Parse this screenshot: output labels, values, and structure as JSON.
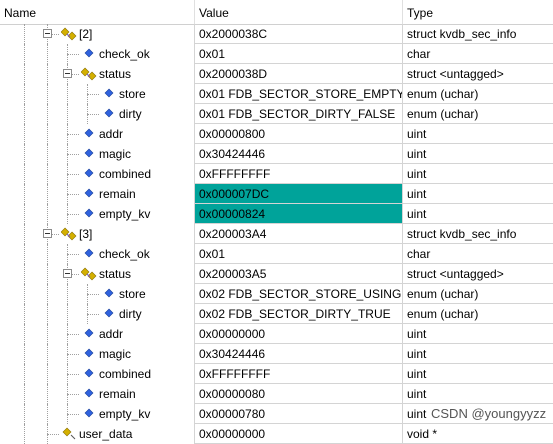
{
  "columns": {
    "name": "Name",
    "value": "Value",
    "type": "Type"
  },
  "rows": [
    {
      "id": "r0",
      "name": "[2]",
      "value": "0x2000038C",
      "type": "struct kvdb_sec_info",
      "level": 0,
      "kind": "struct",
      "expandable": true
    },
    {
      "id": "r1",
      "name": "check_ok",
      "value": "0x01",
      "type": "char",
      "level": 1,
      "kind": "field"
    },
    {
      "id": "r2",
      "name": "status",
      "value": "0x2000038D",
      "type": "struct <untagged>",
      "level": 1,
      "kind": "struct",
      "expandable": true
    },
    {
      "id": "r3",
      "name": "store",
      "value": "0x01 FDB_SECTOR_STORE_EMPTY",
      "type": "enum (uchar)",
      "level": 2,
      "kind": "field"
    },
    {
      "id": "r4",
      "name": "dirty",
      "value": "0x01 FDB_SECTOR_DIRTY_FALSE",
      "type": "enum (uchar)",
      "level": 2,
      "kind": "field"
    },
    {
      "id": "r5",
      "name": "addr",
      "value": "0x00000800",
      "type": "uint",
      "level": 1,
      "kind": "field"
    },
    {
      "id": "r6",
      "name": "magic",
      "value": "0x30424446",
      "type": "uint",
      "level": 1,
      "kind": "field"
    },
    {
      "id": "r7",
      "name": "combined",
      "value": "0xFFFFFFFF",
      "type": "uint",
      "level": 1,
      "kind": "field"
    },
    {
      "id": "r8",
      "name": "remain",
      "value": "0x000007DC",
      "type": "uint",
      "level": 1,
      "kind": "field",
      "changed": true
    },
    {
      "id": "r9",
      "name": "empty_kv",
      "value": "0x00000824",
      "type": "uint",
      "level": 1,
      "kind": "field",
      "changed": true
    },
    {
      "id": "r10",
      "name": "[3]",
      "value": "0x200003A4",
      "type": "struct kvdb_sec_info",
      "level": 0,
      "kind": "struct",
      "expandable": true
    },
    {
      "id": "r11",
      "name": "check_ok",
      "value": "0x01",
      "type": "char",
      "level": 1,
      "kind": "field"
    },
    {
      "id": "r12",
      "name": "status",
      "value": "0x200003A5",
      "type": "struct <untagged>",
      "level": 1,
      "kind": "struct",
      "expandable": true
    },
    {
      "id": "r13",
      "name": "store",
      "value": "0x02 FDB_SECTOR_STORE_USING",
      "type": "enum (uchar)",
      "level": 2,
      "kind": "field"
    },
    {
      "id": "r14",
      "name": "dirty",
      "value": "0x02 FDB_SECTOR_DIRTY_TRUE",
      "type": "enum (uchar)",
      "level": 2,
      "kind": "field"
    },
    {
      "id": "r15",
      "name": "addr",
      "value": "0x00000000",
      "type": "uint",
      "level": 1,
      "kind": "field"
    },
    {
      "id": "r16",
      "name": "magic",
      "value": "0x30424446",
      "type": "uint",
      "level": 1,
      "kind": "field"
    },
    {
      "id": "r17",
      "name": "combined",
      "value": "0xFFFFFFFF",
      "type": "uint",
      "level": 1,
      "kind": "field"
    },
    {
      "id": "r18",
      "name": "remain",
      "value": "0x00000080",
      "type": "uint",
      "level": 1,
      "kind": "field"
    },
    {
      "id": "r19",
      "name": "empty_kv",
      "value": "0x00000780",
      "type": "uint",
      "level": 1,
      "kind": "field"
    },
    {
      "id": "r20",
      "name": "user_data",
      "value": "0x00000000",
      "type": "void *",
      "level": 0,
      "kind": "pointer",
      "partial": true
    }
  ],
  "watermark": "CSDN @youngyyzz",
  "colors": {
    "changed_bg": "#00a39a",
    "struct_icon": "#c8a400",
    "field_icon": "#2a5bd7",
    "pointer_icon": "#c8a400"
  }
}
